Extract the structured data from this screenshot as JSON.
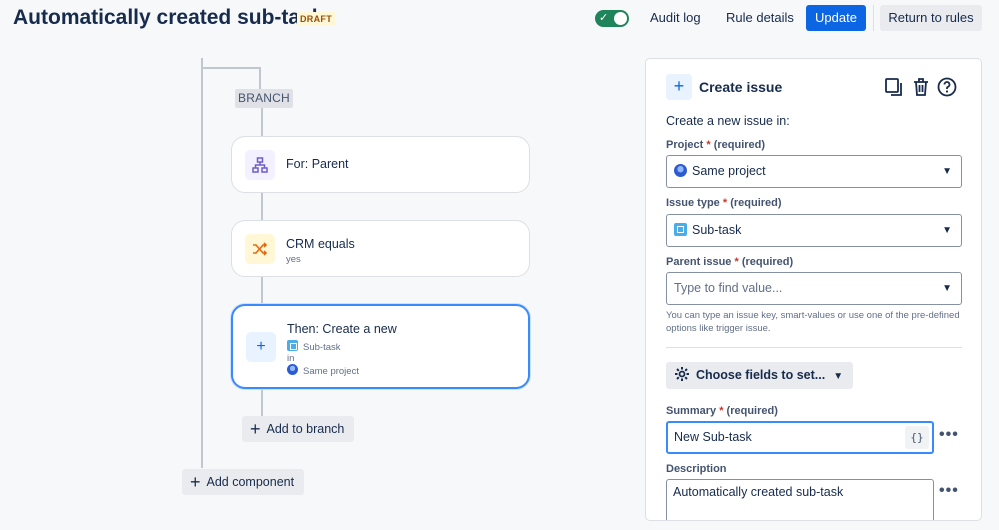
{
  "header": {
    "title": "Automatically created sub-task",
    "status_badge": "DRAFT",
    "rule_enabled": true,
    "audit_log": "Audit log",
    "rule_details": "Rule details",
    "update": "Update",
    "return_to_rules": "Return to rules"
  },
  "canvas": {
    "branch_label": "BRANCH",
    "cards": [
      {
        "title": "For: Parent",
        "icon": "branch-hierarchy-icon"
      },
      {
        "title": "CRM equals",
        "subtitle": "yes",
        "icon": "shuffle-icon"
      },
      {
        "title": "Then: Create a new",
        "issue_type": "Sub-task",
        "in_text": "in",
        "project": "Same project",
        "icon": "plus-icon"
      }
    ],
    "add_to_branch": "Add to branch",
    "add_component": "Add component"
  },
  "panel": {
    "title": "Create issue",
    "intro": "Create a new issue in:",
    "required_text": "(required)",
    "project": {
      "label": "Project",
      "value": "Same project"
    },
    "issue_type": {
      "label": "Issue type",
      "value": "Sub-task"
    },
    "parent_issue": {
      "label": "Parent issue",
      "placeholder": "Type to find value..."
    },
    "help_text": "You can type an issue key, smart-values or use one of the pre-defined options like trigger issue.",
    "choose_fields": "Choose fields to set...",
    "summary": {
      "label": "Summary",
      "value": "New Sub-task",
      "smart_value_button": "{}"
    },
    "description": {
      "label": "Description",
      "value": "Automatically created sub-task"
    },
    "more": "•••"
  },
  "colors": {
    "primary": "#0c66e4",
    "toggle_on": "#1f845a",
    "active_border": "#388bff",
    "required": "#c9372c",
    "draft_text": "#974f0c",
    "draft_bg": "#fff7d6"
  }
}
